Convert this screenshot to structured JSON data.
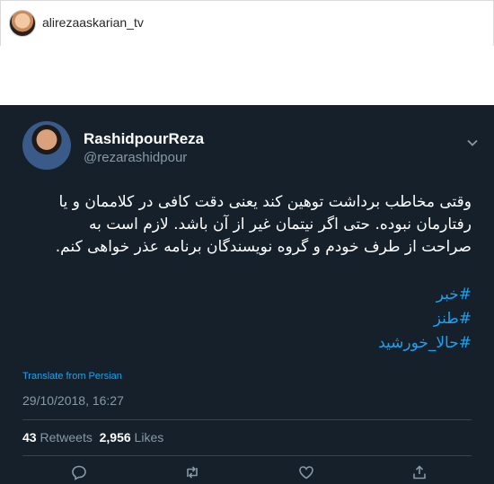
{
  "instagram": {
    "username": "alirezaaskarian_tv"
  },
  "tweet": {
    "display_name": "RashidpourReza",
    "handle": "@rezarashidpour",
    "body_lines": [
      "وقتی مخاطب برداشت توهین کند یعنی دقت کافی در کلاممان و یا",
      "رفتارمان نبوده. حتی اگر نیتمان غیر از آن باشد. لازم است به",
      "صراحت از طرف خودم و گروه نویسندگان برنامه عذر خواهی کنم."
    ],
    "hashtags": [
      "#خبر",
      "#طنز",
      "#حالا_خورشید"
    ],
    "translate_label": "Translate from Persian",
    "timestamp": "29/10/2018, 16:27",
    "retweets_count": "43",
    "retweets_label": "Retweets",
    "likes_count": "2,956",
    "likes_label": "Likes"
  },
  "icons": {
    "menu": "chevron-down-icon",
    "reply": "reply-icon",
    "retweet": "retweet-icon",
    "like": "heart-icon",
    "share": "share-icon"
  },
  "colors": {
    "tweet_bg": "#15202b",
    "link_blue": "#1da1f2",
    "muted_gray": "#8899a6"
  }
}
